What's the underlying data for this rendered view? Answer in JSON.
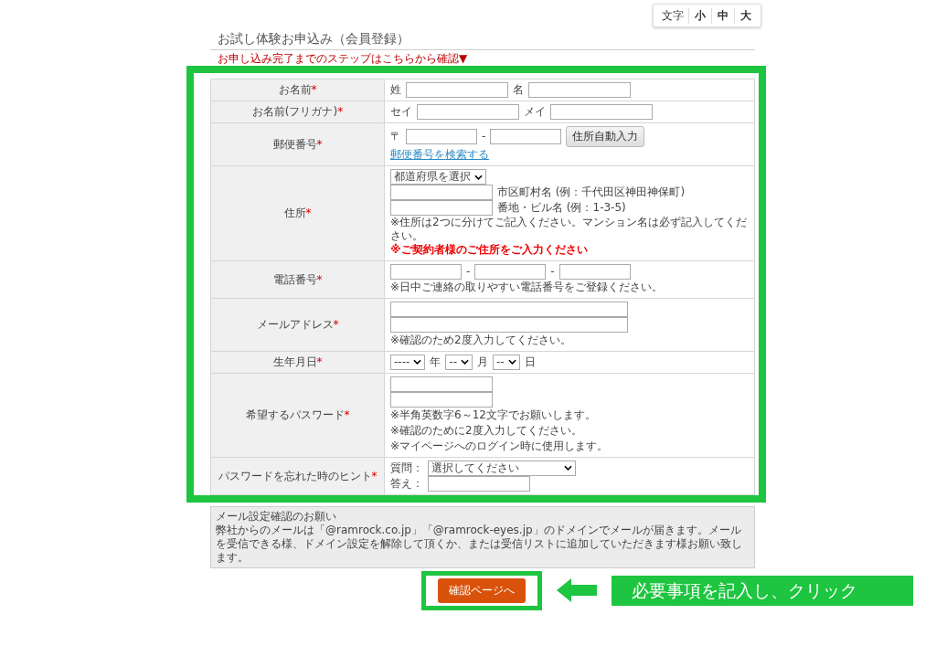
{
  "font_size_switch": {
    "label": "文字",
    "options": [
      {
        "label": "小",
        "selected": false
      },
      {
        "label": "中",
        "selected": false
      },
      {
        "label": "大",
        "selected": false
      }
    ]
  },
  "page_title": "お試し体験お申込み（会員登録）",
  "steps_link": "お申し込み完了までのステップはこちらから確認▼",
  "form": {
    "rows": [
      {
        "label": "お名前",
        "asterisk": "*",
        "lines": [
          [
            {
              "kind": "text",
              "text": "姓"
            },
            {
              "kind": "field"
            },
            {
              "kind": "text",
              "text": "名"
            },
            {
              "kind": "field"
            }
          ]
        ]
      },
      {
        "label": "お名前(フリガナ)",
        "asterisk": "*",
        "lines": [
          [
            {
              "kind": "text",
              "text": "セイ"
            },
            {
              "kind": "field"
            },
            {
              "kind": "text",
              "text": "メイ"
            },
            {
              "kind": "field"
            }
          ]
        ]
      },
      {
        "label": "郵便番号",
        "asterisk": "*",
        "lines": [
          [
            {
              "kind": "text",
              "text": "〒"
            },
            {
              "kind": "short-field"
            },
            {
              "kind": "text",
              "text": "-"
            },
            {
              "kind": "short-field"
            },
            {
              "kind": "button",
              "text": "住所自動入力"
            }
          ],
          [
            {
              "kind": "link",
              "text": "郵便番号を検索する"
            }
          ]
        ]
      },
      {
        "label": "住所",
        "asterisk": "*",
        "lines": [
          [
            {
              "kind": "small-select",
              "text": "都道府県を選択"
            }
          ],
          [
            {
              "kind": "field"
            },
            {
              "kind": "text",
              "text": "市区町村名 (例：千代田区神田神保町)"
            }
          ],
          [
            {
              "kind": "field"
            },
            {
              "kind": "text",
              "text": "番地・ビル名 (例：1-3-5)"
            }
          ],
          [
            {
              "kind": "note",
              "text": "※住所は2つに分けてご記入ください。マンション名は必ず記入してください。"
            }
          ],
          [
            {
              "kind": "warning",
              "text": "※ご契約者様のご住所をご入力ください"
            }
          ]
        ]
      },
      {
        "label": "電話番号",
        "asterisk": "*",
        "lines": [
          [
            {
              "kind": "short-field"
            },
            {
              "kind": "text",
              "text": "-"
            },
            {
              "kind": "short-field"
            },
            {
              "kind": "text",
              "text": "-"
            },
            {
              "kind": "short-field"
            }
          ],
          [
            {
              "kind": "note",
              "text": "※日中ご連絡の取りやすい電話番号をご登録ください。"
            }
          ]
        ]
      },
      {
        "label": "メールアドレス",
        "asterisk": "*",
        "lines": [
          [
            {
              "kind": "wide-field"
            }
          ],
          [
            {
              "kind": "wide-field"
            }
          ],
          [
            {
              "kind": "note",
              "text": "※確認のため2度入力してください。"
            }
          ]
        ]
      },
      {
        "label": "生年月日",
        "asterisk": "*",
        "lines": [
          [
            {
              "kind": "select",
              "text": "----"
            },
            {
              "kind": "text",
              "text": "年"
            },
            {
              "kind": "select",
              "text": "--"
            },
            {
              "kind": "text",
              "text": "月"
            },
            {
              "kind": "select",
              "text": "--"
            },
            {
              "kind": "text",
              "text": "日"
            }
          ]
        ]
      },
      {
        "label": "希望するパスワード",
        "asterisk": "*",
        "lines": [
          [
            {
              "kind": "field"
            }
          ],
          [
            {
              "kind": "field"
            }
          ],
          [
            {
              "kind": "note",
              "text": "※半角英数字6～12文字でお願いします。"
            }
          ],
          [
            {
              "kind": "note",
              "text": "※確認のために2度入力してください。"
            }
          ],
          [
            {
              "kind": "note",
              "text": "※マイページへのログイン時に使用します。"
            }
          ]
        ]
      },
      {
        "label": "パスワードを忘れた時のヒント",
        "asterisk": "*",
        "lines": [
          [
            {
              "kind": "text",
              "text": "質問："
            },
            {
              "kind": "wide-select",
              "text": "選択してください"
            }
          ],
          [
            {
              "kind": "text",
              "text": "答え："
            },
            {
              "kind": "field"
            }
          ]
        ]
      }
    ]
  },
  "notice": {
    "title": "メール設定確認のお願い",
    "body": "弊社からのメールは「@ramrock.co.jp」「@ramrock-eyes.jp」のドメインでメールが届きます。メールを受信できる様、ドメイン設定を解除して頂くか、または受信リストに追加していただきます様お願い致します。"
  },
  "submit_button": "確認ページへ",
  "annotation": {
    "text": "必要事項を記入し、クリック"
  }
}
